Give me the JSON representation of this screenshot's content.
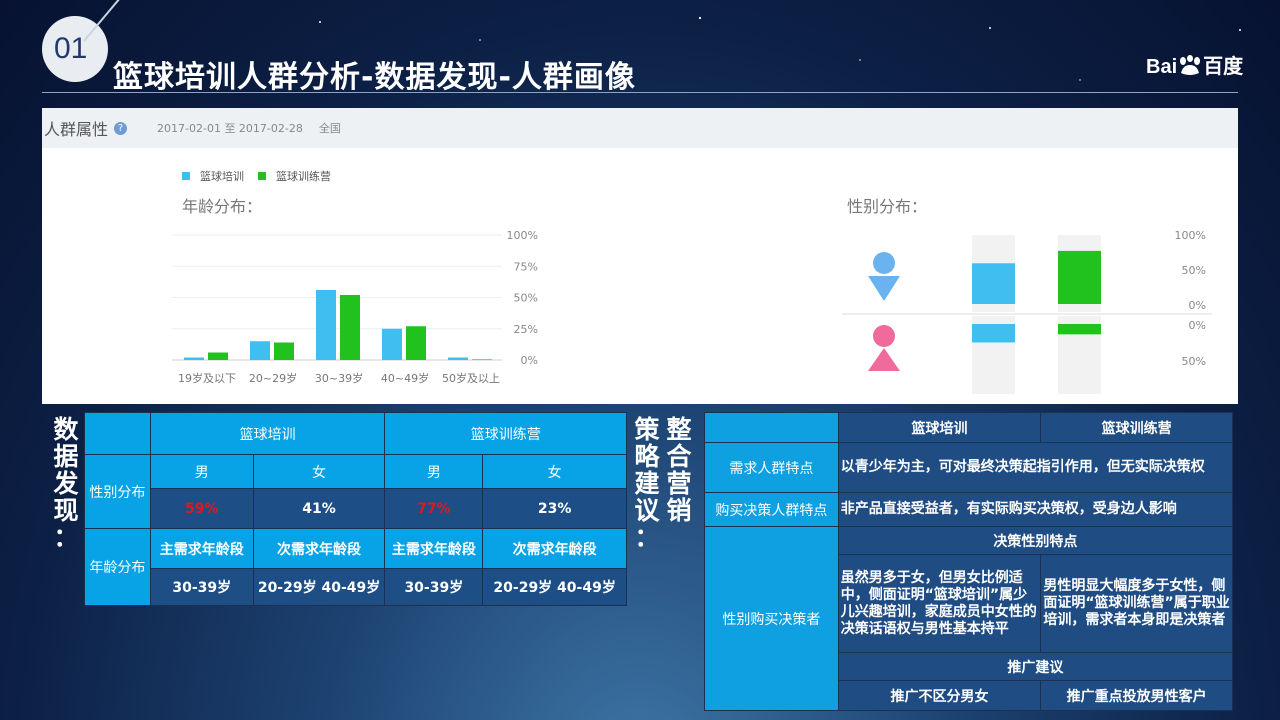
{
  "slide": {
    "number": "01",
    "title": "篮球培训人群分析-数据发现-人群画像",
    "logo_text_left": "Bai",
    "logo_text_right": "百度"
  },
  "panel": {
    "title": "人群属性",
    "help": "?",
    "date_range": "2017-02-01 至 2017-02-28",
    "region": "全国"
  },
  "chart_data": [
    {
      "type": "bar",
      "title": "年龄分布：",
      "categories": [
        "19岁及以下",
        "20~29岁",
        "30~39岁",
        "40~49岁",
        "50岁及以上"
      ],
      "series": [
        {
          "name": "篮球培训",
          "color": "#3fbff0",
          "values": [
            2,
            15,
            56,
            25,
            2
          ]
        },
        {
          "name": "篮球训练营",
          "color": "#22c21e",
          "values": [
            6,
            14,
            52,
            27,
            0.5
          ]
        }
      ],
      "y_ticks": [
        "100%",
        "75%",
        "50%",
        "25%",
        "0%"
      ],
      "ylim": [
        0,
        100
      ]
    },
    {
      "type": "bar",
      "title": "性别分布：",
      "categories": [
        "男",
        "女"
      ],
      "series": [
        {
          "name": "篮球培训",
          "color": "#3fbff0",
          "values": [
            59,
            41
          ]
        },
        {
          "name": "篮球训练营",
          "color": "#22c21e",
          "values": [
            77,
            23
          ]
        }
      ],
      "y_ticks_top": [
        "100%",
        "50%",
        "0%"
      ],
      "y_ticks_bottom": [
        "0%",
        "50%"
      ]
    }
  ],
  "left_label": [
    "数",
    "据",
    "发",
    "现",
    "："
  ],
  "mid_label_1": [
    "策",
    "略",
    "建",
    "议",
    "："
  ],
  "mid_label_2": [
    "整",
    "合",
    "营",
    "销"
  ],
  "table1": {
    "col_training": "篮球培训",
    "col_camp": "篮球训练营",
    "row_gender": "性别分布",
    "male": "男",
    "female": "女",
    "training_male": "59%",
    "training_female": "41%",
    "camp_male": "77%",
    "camp_female": "23%",
    "row_age": "年龄分布",
    "main_age": "主需求年龄段",
    "sub_age": "次需求年龄段",
    "training_main": "30-39岁",
    "training_sub": "20-29岁 40-49岁",
    "camp_main": "30-39岁",
    "camp_sub": "20-29岁 40-49岁"
  },
  "table2": {
    "col_training": "篮球培训",
    "col_camp": "篮球训练营",
    "row_need": "需求人群特点",
    "need_text": "以青少年为主，可对最终决策起指引作用，但无实际决策权",
    "row_buy": "购买决策人群特点",
    "buy_text": "非产品直接受益者，有实际购买决策权，受身边人影响",
    "row_gender_buyer": "性别购买决策者",
    "gender_feature": "决策性别特点",
    "training_feature": "虽然男多于女，但男女比例适中，侧面证明“篮球培训”属少儿兴趣培训，家庭成员中女性的决策话语权与男性基本持平",
    "camp_feature": "男性明显大幅度多于女性，侧面证明“篮球训练营”属于职业培训，需求者本身即是决策者",
    "promo": "推广建议",
    "training_promo": "推广不区分男女",
    "camp_promo": "推广重点投放男性客户"
  }
}
